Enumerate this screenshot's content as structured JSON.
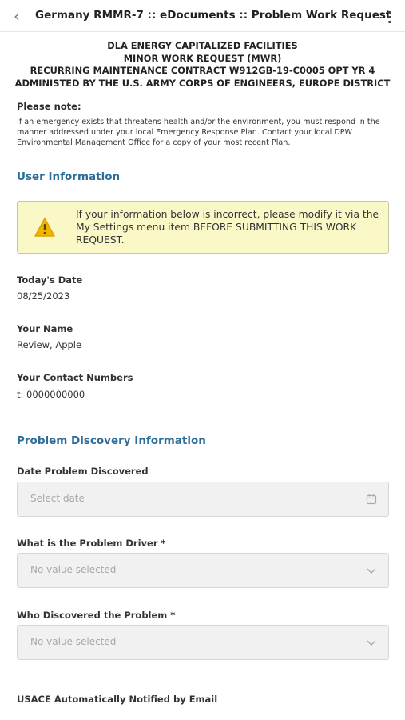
{
  "topbar": {
    "back_icon": "chevron-left-icon",
    "title": "Germany RMMR-7 :: eDocuments :: Problem Work Request",
    "menu_icon": "more-vertical-icon"
  },
  "header": {
    "lines": [
      "DLA ENERGY CAPITALIZED FACILITIES",
      "MINOR WORK REQUEST (MWR)",
      "RECURRING MAINTENANCE CONTRACT W912GB-19-C0005 OPT YR 4",
      "ADMINISTED BY THE U.S. ARMY CORPS OF ENGINEERS, EUROPE DISTRICT"
    ]
  },
  "note": {
    "title": "Please note:",
    "body": "If an emergency exists that threatens health and/or the environment, you must respond in the manner addressed under your local Emergency Response Plan. Contact your local DPW Environmental Management Office for a copy of your most recent Plan."
  },
  "user_info": {
    "section_title": "User Information",
    "alert_icon": "warning-icon",
    "alert_color": "#fbf8c8",
    "alert_text": "If your information below is incorrect, please modify it via the My Settings menu item BEFORE SUBMITTING THIS WORK REQUEST.",
    "date_label": "Today's Date",
    "date_value": "08/25/2023",
    "name_label": "Your Name",
    "name_value": "Review, Apple",
    "contact_label": "Your Contact Numbers",
    "contact_value": "t: 0000000000"
  },
  "problem_info": {
    "section_title": "Problem Discovery Information",
    "date_discovered_label": "Date Problem Discovered",
    "date_discovered_placeholder": "Select date",
    "calendar_icon": "calendar-icon",
    "driver_label": "What is the Problem Driver *",
    "driver_placeholder": "No value selected",
    "discoverer_label": "Who Discovered the Problem *",
    "discoverer_placeholder": "No value selected",
    "dropdown_icon": "chevron-down-icon",
    "usace_label": "USACE Automatically Notified by Email"
  },
  "colors": {
    "section_title": "#2d6d97",
    "warning_icon": "#f2b300"
  }
}
